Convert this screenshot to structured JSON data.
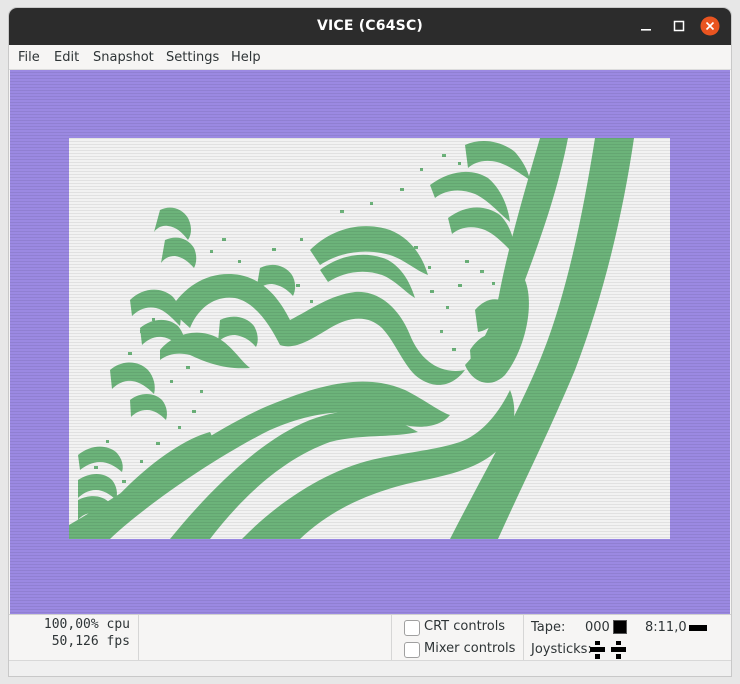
{
  "window": {
    "title": "VICE (C64SC)"
  },
  "menu": [
    "File",
    "Edit",
    "Snapshot",
    "Settings",
    "Help"
  ],
  "screen": {
    "border_color": "#9b89e2",
    "background_color": "#f2f2f2",
    "fractal_color": "#6cb37a",
    "content": "julia-fractal-graphic"
  },
  "status": {
    "cpu": "100,00% cpu",
    "fps": "50,126 fps",
    "crt_controls": {
      "label": "CRT controls",
      "checked": false
    },
    "mixer_controls": {
      "label": "Mixer controls",
      "checked": false
    },
    "tape_label": "Tape:",
    "tape_counter": "000",
    "drive_status": "8:11,0",
    "joysticks_label": "Joysticks:"
  },
  "icons": {
    "close": "close-icon",
    "maximize": "maximize-icon",
    "minimize": "minimize-icon",
    "tape_stop": "tape-stop-icon",
    "drive_led": "drive-led-icon",
    "joystick": "joystick-icon"
  },
  "colors": {
    "titlebar": "#2c2c2c",
    "close_button": "#e95420"
  }
}
